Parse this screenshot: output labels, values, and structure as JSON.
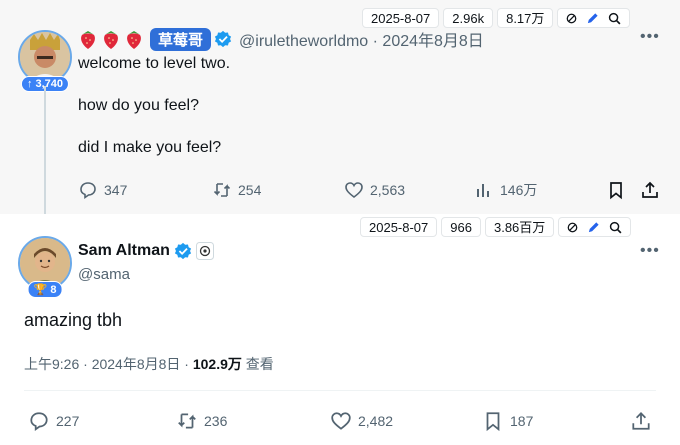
{
  "parent": {
    "meta": {
      "date": "2025-8-07",
      "replies_stat": "2.96k",
      "views_stat": "8.17万"
    },
    "avatar_badge": "↑ 3,740",
    "display_name_tag": "草莓哥",
    "handle_time": "@iruletheworldmo · 2024年8月8日",
    "lines": [
      "welcome to level two.",
      "how do you feel?",
      "did I make you feel?"
    ],
    "actions": {
      "replies": "347",
      "reposts": "254",
      "likes": "2,563",
      "views": "146万"
    }
  },
  "main": {
    "meta": {
      "date": "2025-8-07",
      "replies_stat": "966",
      "views_stat": "3.86百万"
    },
    "avatar_badge": "🏆 8",
    "name": "Sam Altman",
    "handle": "@sama",
    "text": "amazing tbh",
    "time": "上午9:26 · 2024年8月8日 · ",
    "views_count": "102.9万",
    "views_label": " 查看",
    "actions": {
      "replies": "227",
      "reposts": "236",
      "likes": "2,482",
      "bookmarks": "187"
    }
  },
  "colors": {
    "accent": "#1d9bf0",
    "brand_tag": "#2f6fd8",
    "badge": "#3b82f6",
    "strawberry": "#e0283a"
  },
  "icons": [
    "strawberry-icon",
    "verified-badge-icon",
    "openai-icon",
    "more-icon",
    "reply-icon",
    "repost-icon",
    "like-icon",
    "views-icon",
    "bookmark-icon",
    "share-icon",
    "block-icon",
    "pencil-icon",
    "search-icon"
  ]
}
